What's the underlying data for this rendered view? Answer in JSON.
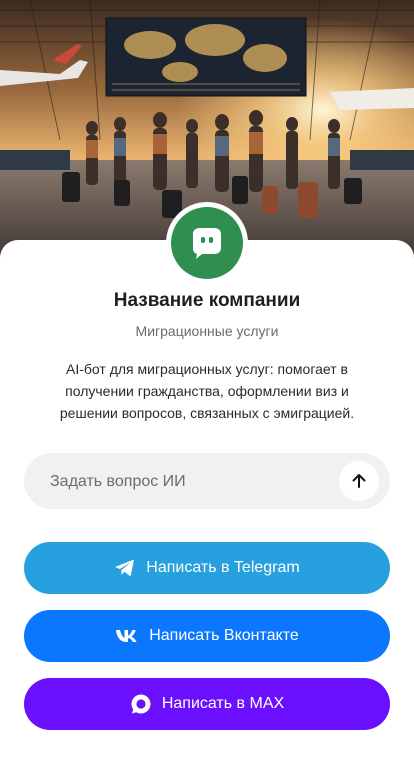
{
  "company": {
    "name": "Название компании",
    "subtitle": "Миграционные услуги",
    "description": "AI-бот для миграционных услуг: помогает в получении гражданства, оформлении виз и решении вопросов, связанных с эмиграцией."
  },
  "hero": {
    "icon": "airport-travelers-photo"
  },
  "avatar": {
    "icon": "chat-bot-icon",
    "color": "#2f8f4e"
  },
  "ask": {
    "placeholder": "Задать вопрос ИИ",
    "value": "",
    "send_icon": "arrow-up-icon"
  },
  "buttons": [
    {
      "label": "Написать в Telegram",
      "icon": "telegram-icon",
      "color": "#27a0df"
    },
    {
      "label": "Написать Вконтакте",
      "icon": "vk-icon",
      "color": "#0b77ff"
    },
    {
      "label": "Написать в MAX",
      "icon": "max-icon",
      "color": "#6b10ff"
    }
  ]
}
